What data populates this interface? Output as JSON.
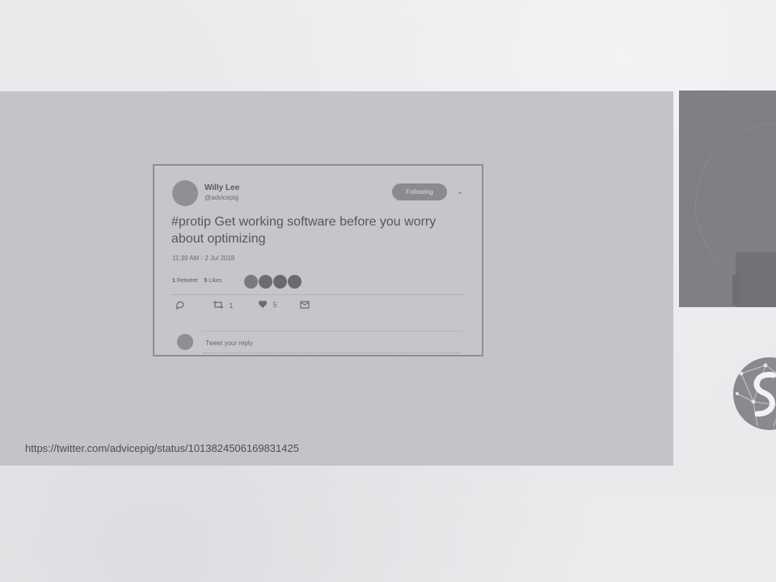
{
  "tweet": {
    "author_name": "Willy Lee",
    "author_handle": "@advicepig",
    "follow_label": "Following",
    "text": "#protip Get working software before you worry about optimizing",
    "timestamp": "11:39 AM - 2 Jul 2018",
    "retweets_count": "1",
    "retweets_label": "Retweet",
    "likes_count": "5",
    "likes_label": "Likes",
    "reply_count": "",
    "retweet_action_count": "1",
    "like_action_count": "5",
    "reply_placeholder": "Tweet your reply"
  },
  "slide": {
    "url": "https://twitter.com/advicepig/status/1013824506169831425"
  },
  "icons": {
    "reply": "reply-icon",
    "retweet": "retweet-icon",
    "like": "heart-icon",
    "dm": "envelope-icon",
    "caret": "chevron-down-icon"
  },
  "colors": {
    "panel": "#c4c3c7",
    "card_border": "#8e8d91",
    "follow_button": "#8b8a8e"
  }
}
